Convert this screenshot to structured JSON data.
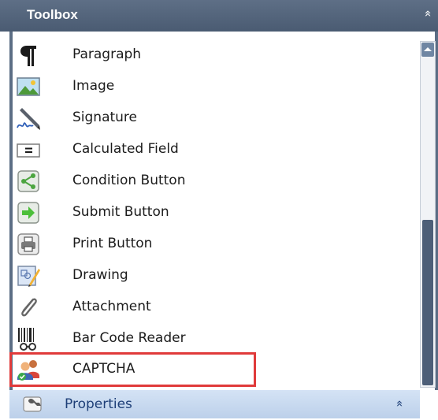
{
  "header": {
    "title": "Toolbox",
    "collapse_glyph": "»"
  },
  "items": [
    {
      "label": "Paragraph",
      "icon": "paragraph-icon"
    },
    {
      "label": "Image",
      "icon": "image-icon"
    },
    {
      "label": "Signature",
      "icon": "signature-icon"
    },
    {
      "label": "Calculated Field",
      "icon": "calculated-field-icon"
    },
    {
      "label": "Condition Button",
      "icon": "condition-button-icon"
    },
    {
      "label": "Submit Button",
      "icon": "submit-button-icon"
    },
    {
      "label": "Print Button",
      "icon": "print-button-icon"
    },
    {
      "label": "Drawing",
      "icon": "drawing-icon"
    },
    {
      "label": "Attachment",
      "icon": "attachment-icon"
    },
    {
      "label": "Bar Code Reader",
      "icon": "barcode-icon"
    },
    {
      "label": "CAPTCHA",
      "icon": "captcha-icon"
    }
  ],
  "properties": {
    "label": "Properties",
    "icon": "wrench-icon",
    "chevron": "»"
  },
  "colors": {
    "header": "#4f6078",
    "highlight": "#e03a3a",
    "properties_bg": "#c8d9ef"
  }
}
